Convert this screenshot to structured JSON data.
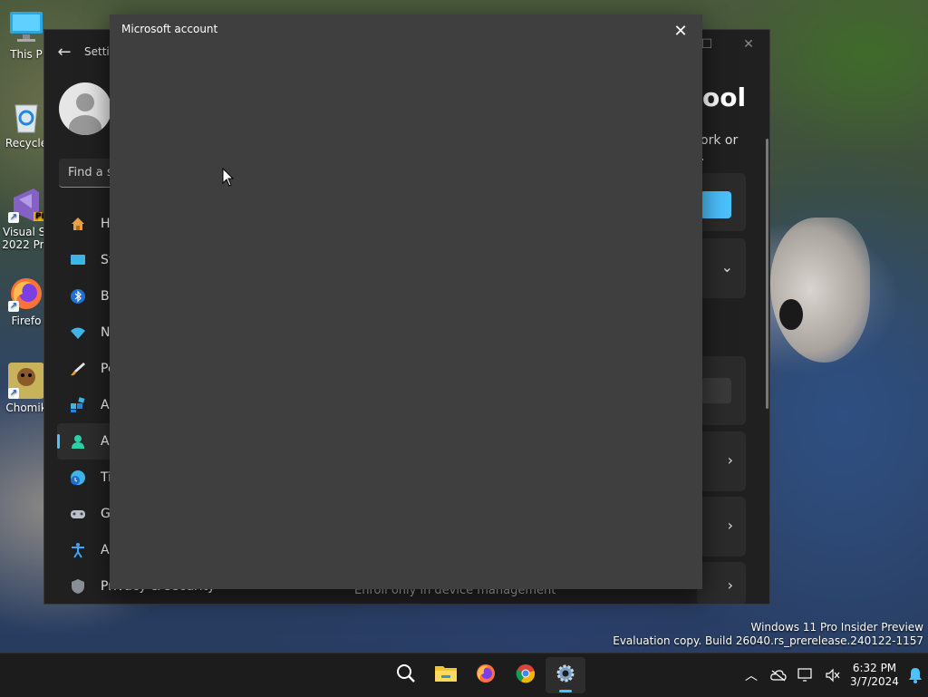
{
  "desktop": {
    "icons": [
      {
        "label": "This P",
        "icon": "monitor-icon"
      },
      {
        "label": "Recycle",
        "icon": "recycle-bin-icon"
      },
      {
        "label": "Visual St",
        "label2": "2022 Pre",
        "icon": "visual-studio-icon",
        "badge": "PI"
      },
      {
        "label": "Firefo",
        "icon": "firefox-icon"
      },
      {
        "label": "Chomik",
        "icon": "chomikbox-icon"
      }
    ]
  },
  "settings_window": {
    "title": "Setti",
    "search_placeholder": "Find a s",
    "nav_items": [
      {
        "label": "Ho",
        "icon": "home-icon"
      },
      {
        "label": "Sy",
        "icon": "system-icon"
      },
      {
        "label": "Bl",
        "icon": "bluetooth-icon"
      },
      {
        "label": "Ne",
        "icon": "network-icon"
      },
      {
        "label": "Pe",
        "icon": "personalization-icon"
      },
      {
        "label": "Ap",
        "icon": "apps-icon"
      },
      {
        "label": "Ac",
        "icon": "accounts-icon",
        "active": true
      },
      {
        "label": "Ti",
        "icon": "time-language-icon"
      },
      {
        "label": "Ga",
        "icon": "gaming-icon"
      },
      {
        "label": "Ac",
        "icon": "accessibility-icon"
      },
      {
        "label": "Privacy & security",
        "icon": "privacy-shield-icon"
      }
    ],
    "content_heading": "ool",
    "content_desc_line1": "ork or",
    "content_desc_line2": ".",
    "enroll_link": "Enroll only in device management"
  },
  "dialog": {
    "title": "Microsoft account",
    "close_glyph": "✕"
  },
  "watermark": {
    "line1": "Windows 11 Pro Insider Preview",
    "line2": "Evaluation copy. Build 26040.rs_prerelease.240122-1157"
  },
  "taskbar": {
    "apps": [
      {
        "name": "search",
        "icon": "search-icon"
      },
      {
        "name": "file-explorer",
        "icon": "folder-icon"
      },
      {
        "name": "firefox",
        "icon": "firefox-icon"
      },
      {
        "name": "chrome",
        "icon": "chrome-icon"
      },
      {
        "name": "settings",
        "icon": "gear-icon",
        "active": true
      }
    ],
    "time": "6:32 PM",
    "date": "3/7/2024"
  },
  "colors": {
    "accent": "#4cc2ff",
    "dialog_bg": "#3f3f3f",
    "settings_bg": "#202020",
    "taskbar_bg": "#1c1c1c"
  }
}
